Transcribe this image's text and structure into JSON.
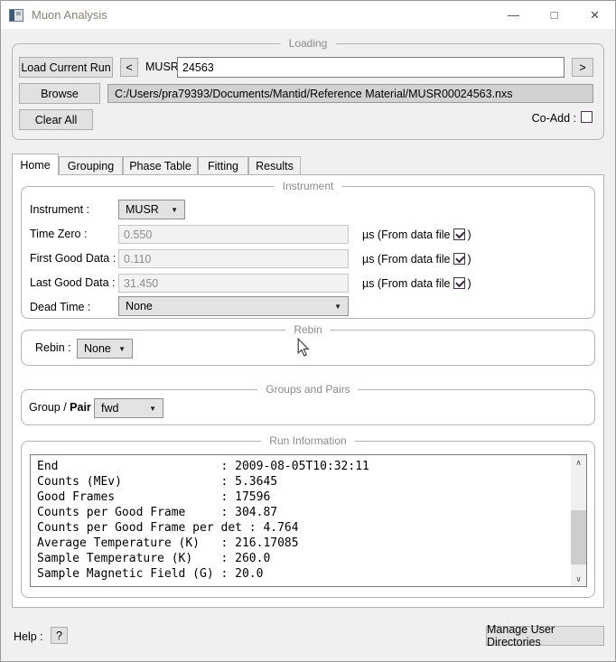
{
  "window": {
    "title": "Muon Analysis",
    "minimize_glyph": "—",
    "maximize_glyph": "□",
    "close_glyph": "×"
  },
  "loading": {
    "group_title": "Loading",
    "load_current_run": "Load Current Run",
    "prev_glyph": "<",
    "next_glyph": ">",
    "instrument_prefix": "MUSR",
    "run_number": "24563",
    "browse": "Browse",
    "file_path": "C:/Users/pra79393/Documents/Mantid/Reference Material/MUSR00024563.nxs",
    "clear_all": "Clear All",
    "co_add_label": "Co-Add :",
    "co_add_checked": false
  },
  "tabs": [
    {
      "label": "Home",
      "active": true
    },
    {
      "label": "Grouping",
      "active": false
    },
    {
      "label": "Phase Table",
      "active": false
    },
    {
      "label": "Fitting",
      "active": false
    },
    {
      "label": "Results",
      "active": false
    }
  ],
  "instrument": {
    "group_title": "Instrument",
    "instrument_label": "Instrument :",
    "instrument_value": "MUSR",
    "time_zero_label": "Time Zero :",
    "time_zero_value": "0.550",
    "first_good_label": "First Good Data :",
    "first_good_value": "0.110",
    "last_good_label": "Last Good Data :",
    "last_good_value": "31.450",
    "dead_time_label": "Dead Time :",
    "dead_time_value": "None",
    "unit_label": "µs (From data file",
    "unit_suffix": ")",
    "from_data_file_checked": true
  },
  "rebin": {
    "group_title": "Rebin",
    "label": "Rebin :",
    "value": "None"
  },
  "groups_pairs": {
    "group_title": "Groups and Pairs",
    "label_prefix": "Group /",
    "label_bold": "Pair :",
    "value": "fwd"
  },
  "run_information": {
    "group_title": "Run Information",
    "lines": [
      "End                       : 2009-08-05T10:32:11",
      "Counts (MEv)              : 5.3645",
      "Good Frames               : 17596",
      "Counts per Good Frame     : 304.87",
      "Counts per Good Frame per det : 4.764",
      "Average Temperature (K)   : 216.17085",
      "Sample Temperature (K)    : 260.0",
      "Sample Magnetic Field (G) : 20.0"
    ]
  },
  "icons": {
    "combo_arrow": "▼",
    "scroll_up": "∧",
    "scroll_down": "∨"
  },
  "footer": {
    "help_label": "Help :",
    "help_button": "?",
    "manage_button": "Manage User Directories"
  },
  "colors": {
    "window_bg": "#f0f0f0",
    "titlebar_bg": "#ffffff",
    "pane_bg": "#ffffff",
    "group_border": "#b3b3b3",
    "group_title_text": "#8a8a8a",
    "button_bg": "#e1e1e1",
    "input_border": "#7a7a7a",
    "disabled_text": "#8c8c8c",
    "path_field_bg": "#d2d2d2",
    "checkbox_border": "#4c3050",
    "scroll_thumb": "#cdcdcd"
  }
}
